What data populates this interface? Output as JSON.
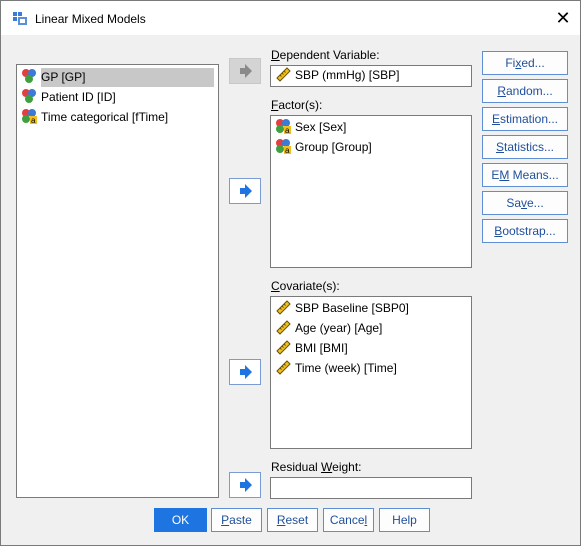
{
  "window": {
    "title": "Linear Mixed Models",
    "close_glyph": "✕"
  },
  "variables": [
    {
      "label": "GP [GP]",
      "icon": "nominal-icon",
      "selected": true
    },
    {
      "label": "Patient ID [ID]",
      "icon": "nominal-icon",
      "selected": false
    },
    {
      "label": "Time categorical [fTime]",
      "icon": "nominal-string-icon",
      "selected": false
    }
  ],
  "dependent": {
    "label_prefix": "D",
    "label_rest": "ependent Variable:",
    "value": "SBP (mmHg) [SBP]",
    "icon": "scale-ruler-icon"
  },
  "factors": {
    "label_prefix": "F",
    "label_rest": "actor(s):",
    "items": [
      {
        "label": "Sex [Sex]",
        "icon": "nominal-string-icon"
      },
      {
        "label": "Group [Group]",
        "icon": "nominal-string-icon"
      }
    ]
  },
  "covariates": {
    "label_prefix": "C",
    "label_rest": "ovariate(s):",
    "items": [
      {
        "label": "SBP Baseline [SBP0]",
        "icon": "scale-ruler-icon"
      },
      {
        "label": "Age (year) [Age]",
        "icon": "scale-ruler-icon"
      },
      {
        "label": "BMI [BMI]",
        "icon": "scale-ruler-icon"
      },
      {
        "label": "Time (week) [Time]",
        "icon": "scale-ruler-icon"
      }
    ]
  },
  "residual_weight": {
    "label_pre": "Residual ",
    "label_u": "W",
    "label_post": "eight:",
    "value": ""
  },
  "side_buttons": [
    {
      "pre": "Fi",
      "u": "x",
      "post": "ed..."
    },
    {
      "pre": "",
      "u": "R",
      "post": "andom..."
    },
    {
      "pre": "",
      "u": "E",
      "post": "stimation..."
    },
    {
      "pre": "",
      "u": "S",
      "post": "tatistics..."
    },
    {
      "pre": "E",
      "u": "M",
      "post": " Means..."
    },
    {
      "pre": "Sa",
      "u": "v",
      "post": "e..."
    },
    {
      "pre": "",
      "u": "B",
      "post": "ootstrap..."
    }
  ],
  "bottom_buttons": {
    "ok": {
      "pre": "OK",
      "u": "",
      "post": ""
    },
    "paste": {
      "pre": "",
      "u": "P",
      "post": "aste"
    },
    "reset": {
      "pre": "",
      "u": "R",
      "post": "eset"
    },
    "cancel": {
      "pre": "Cance",
      "u": "l",
      "post": ""
    },
    "help": {
      "pre": "Help",
      "u": "",
      "post": ""
    }
  },
  "colors": {
    "accent": "#1e74e0",
    "button_border": "#5e8fd4",
    "button_text": "#1f4f9c"
  }
}
